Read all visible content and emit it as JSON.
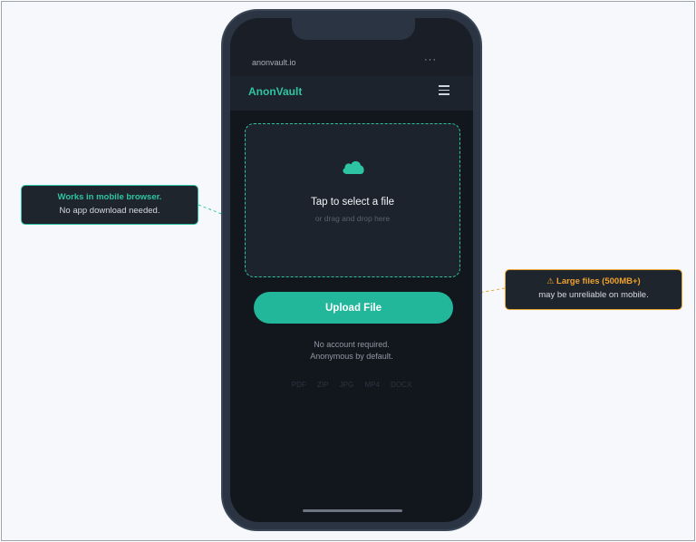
{
  "browser": {
    "url": "anonvault.io",
    "more_label": "···"
  },
  "app": {
    "brand": "AnonVault"
  },
  "dropzone": {
    "title": "Tap to select a file",
    "subtitle": "or drag and drop here"
  },
  "upload_button": {
    "label": "Upload File"
  },
  "note": {
    "line1": "No account required.",
    "line2": "Anonymous by default."
  },
  "formats": [
    "PDF",
    "ZIP",
    "JPG",
    "MP4",
    "DOCX"
  ],
  "callouts": {
    "left": {
      "title": "Works in mobile browser.",
      "text": "No app download needed."
    },
    "right": {
      "title": "Large files (500MB+)",
      "text": "may be unreliable on mobile."
    }
  },
  "colors": {
    "accent": "#2ec4a3",
    "button": "#22b69b",
    "warning": "#f0a22e",
    "screen_bg": "#12161d"
  },
  "icons": {
    "cloud": "cloud-icon",
    "menu": "hamburger-menu-icon",
    "warning": "warning-icon"
  }
}
